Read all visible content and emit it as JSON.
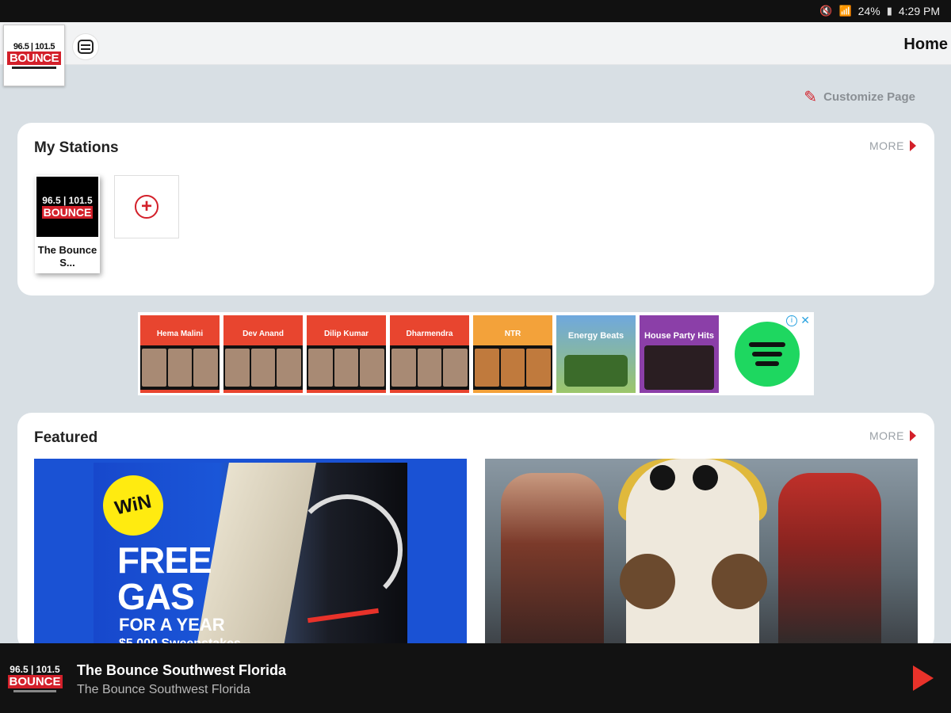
{
  "status_bar": {
    "battery": "24%",
    "time": "4:29 PM"
  },
  "header": {
    "logo": {
      "frequency": "96.5 | 101.5",
      "name": "BOUNCE"
    },
    "title": "Home"
  },
  "customize": {
    "label": "Customize Page"
  },
  "my_stations": {
    "title": "My Stations",
    "more_label": "MORE",
    "stations": [
      {
        "logo_frequency": "96.5 | 101.5",
        "logo_name": "BOUNCE",
        "name": "The Bounce S..."
      }
    ]
  },
  "ad": {
    "tiles": [
      {
        "label": "Hema Malini",
        "style": "red"
      },
      {
        "label": "Dev Anand",
        "style": "red"
      },
      {
        "label": "Dilip Kumar",
        "style": "red"
      },
      {
        "label": "Dharmendra",
        "style": "red"
      },
      {
        "label": "NTR",
        "style": "orange"
      },
      {
        "label": "Energy Beats",
        "style": "sky"
      },
      {
        "label": "House Party Hits",
        "style": "purple"
      }
    ],
    "brand_icon": "spotify-logo",
    "info_glyph": "i",
    "close_glyph": "✕"
  },
  "featured": {
    "title": "Featured",
    "more_label": "MORE",
    "items": [
      {
        "badge": "WiN",
        "line1": "FREE",
        "line2": "GAS",
        "line3": "FOR A YEAR",
        "line4": "$5,000 Sweepstakes"
      },
      {
        "description": "cosplay"
      }
    ]
  },
  "player": {
    "logo": {
      "frequency": "96.5 | 101.5",
      "name": "BOUNCE"
    },
    "title": "The Bounce Southwest Florida",
    "subtitle": "The Bounce Southwest Florida"
  },
  "colors": {
    "accent": "#d3202a",
    "background": "#d8dfe4",
    "player_bg": "#121212"
  }
}
